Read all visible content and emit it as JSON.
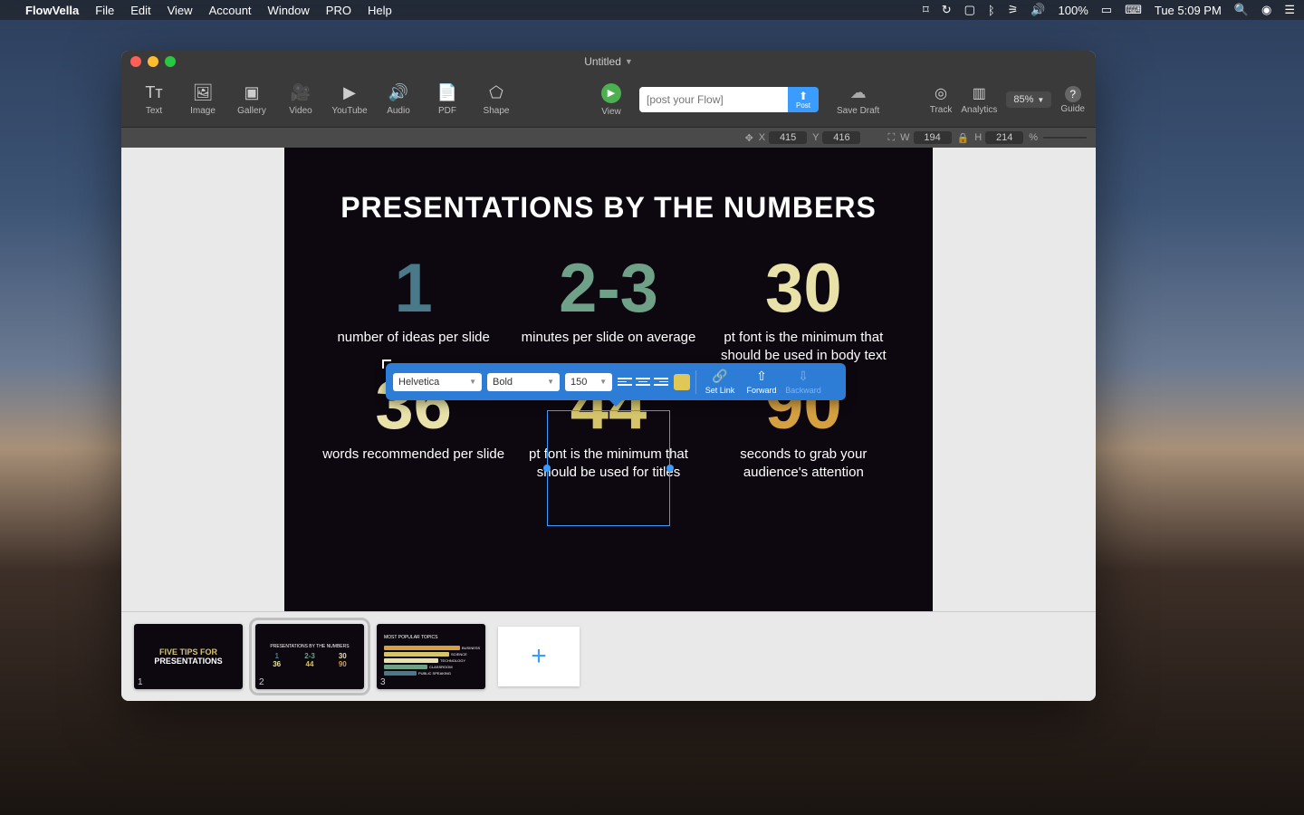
{
  "menubar": {
    "app": "FlowVella",
    "items": [
      "File",
      "Edit",
      "View",
      "Account",
      "Window",
      "PRO",
      "Help"
    ],
    "battery": "100%",
    "clock": "Tue 5:09 PM"
  },
  "window": {
    "title": "Untitled"
  },
  "toolbar": {
    "text": "Text",
    "image": "Image",
    "gallery": "Gallery",
    "video": "Video",
    "youtube": "YouTube",
    "audio": "Audio",
    "pdf": "PDF",
    "shape": "Shape",
    "view": "View",
    "post_placeholder": "[post your Flow]",
    "post": "Post",
    "savedraft": "Save Draft",
    "track": "Track",
    "analytics": "Analytics",
    "zoom": "85%",
    "guide": "Guide"
  },
  "coords": {
    "x_label": "X",
    "x": "415",
    "y_label": "Y",
    "y": "416",
    "w_label": "W",
    "w": "194",
    "h_label": "H",
    "h": "214",
    "pct": "%"
  },
  "slide": {
    "title": "PRESENTATIONS BY THE NUMBERS",
    "cells": [
      {
        "big": "1",
        "cap": "number of ideas per slide"
      },
      {
        "big": "2-3",
        "cap": "minutes per slide on average"
      },
      {
        "big": "30",
        "cap": "pt font is the minimum that should be used in body text"
      },
      {
        "big": "36",
        "cap": "words recommended per slide"
      },
      {
        "big": "44",
        "cap": "pt font is the minimum that should be used for titles"
      },
      {
        "big": "90",
        "cap": "seconds to grab your audience's attention"
      }
    ]
  },
  "floatbar": {
    "font": "Helvetica",
    "weight": "Bold",
    "size": "150",
    "setlink": "Set Link",
    "forward": "Forward",
    "backward": "Backward"
  },
  "thumbs": {
    "t1_line1": "FIVE TIPS FOR",
    "t1_line2": "PRESENTATIONS",
    "t2_title": "PRESENTATIONS BY THE NUMBERS",
    "t3_title": "MOST POPULAR TOPICS",
    "t3_labels": [
      "BUSINESS",
      "SCIENCE",
      "TECHNOLOGY",
      "CLASSROOM",
      "PUBLIC SPEAKING"
    ],
    "n1": "1",
    "n2": "2",
    "n3": "3"
  }
}
